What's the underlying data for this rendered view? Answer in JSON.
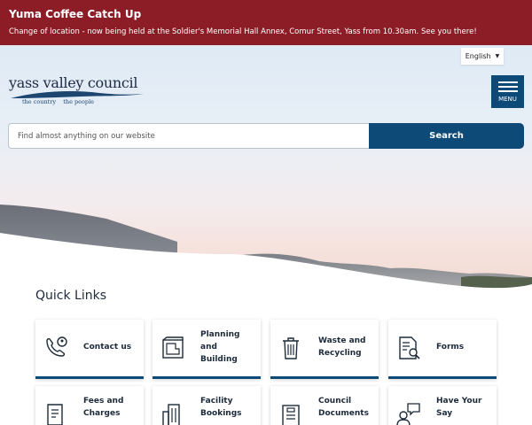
{
  "alert": {
    "title": "Yuma Coffee Catch Up",
    "message": "Change of location - now being held at the Soldier's Memorial Hall Annex, Comur Street, Yass from 10.30am. See you there!"
  },
  "language": {
    "selected": "English"
  },
  "logo": {
    "name": "yass valley council",
    "tag1": "the country",
    "tag2": "the people"
  },
  "menu": {
    "label": "MENU"
  },
  "search": {
    "placeholder": "Find almost anything on our website",
    "button": "Search"
  },
  "quick_links": {
    "title": "Quick Links",
    "items": [
      {
        "label": "Contact us",
        "icon": "phone-contact-icon"
      },
      {
        "label": "Planning and Building",
        "icon": "blueprint-icon"
      },
      {
        "label": "Waste and Recycling",
        "icon": "bin-icon"
      },
      {
        "label": "Forms",
        "icon": "document-search-icon"
      },
      {
        "label": "Fees and Charges",
        "icon": "receipt-icon"
      },
      {
        "label": "Facility Bookings",
        "icon": "building-icon"
      },
      {
        "label": "Council Documents",
        "icon": "document-icon"
      },
      {
        "label": "Have Your Say",
        "icon": "speech-person-icon"
      }
    ]
  },
  "colors": {
    "alert": "#8c1d27",
    "brand": "#0d4a78",
    "text": "#1c2a3a"
  }
}
